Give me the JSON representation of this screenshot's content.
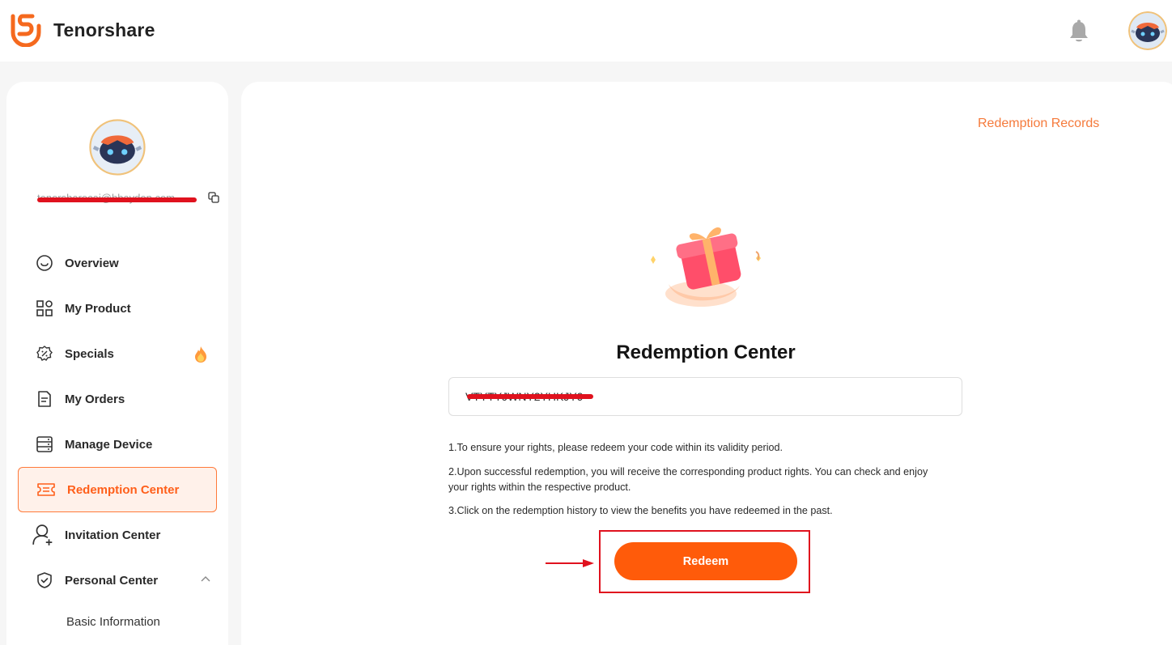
{
  "header": {
    "brand": "Tenorshare",
    "brand_color": "#f5691e"
  },
  "sidebar": {
    "email": "tenorsharecai@hbaydon.com",
    "items": [
      {
        "label": "Overview",
        "icon": "smile-circle-icon"
      },
      {
        "label": "My Product",
        "icon": "grid-icon"
      },
      {
        "label": "Specials",
        "icon": "discount-badge-icon",
        "badge": "fire-icon"
      },
      {
        "label": "My Orders",
        "icon": "document-icon"
      },
      {
        "label": "Manage Device",
        "icon": "server-icon"
      },
      {
        "label": "Redemption Center",
        "icon": "ticket-icon",
        "active": true
      },
      {
        "label": "Invitation Center",
        "icon": "user-add-icon"
      },
      {
        "label": "Personal Center",
        "icon": "shield-check-icon",
        "expanded": true
      }
    ],
    "sub_items": [
      "Basic Information"
    ]
  },
  "main": {
    "records_link": "Redemption Records",
    "title": "Redemption Center",
    "code_value": "VTYTYJWNY2YHKJY9",
    "notes": [
      "1.To ensure your rights, please redeem your code within its validity period.",
      "2.Upon successful redemption, you will receive the corresponding product rights. You can check and enjoy your rights within the respective product.",
      "3.Click on the redemption history to view the benefits you have redeemed in the past."
    ],
    "redeem_label": "Redeem",
    "accent_color": "#ff5b0a",
    "annotation_color": "#e0121e"
  }
}
